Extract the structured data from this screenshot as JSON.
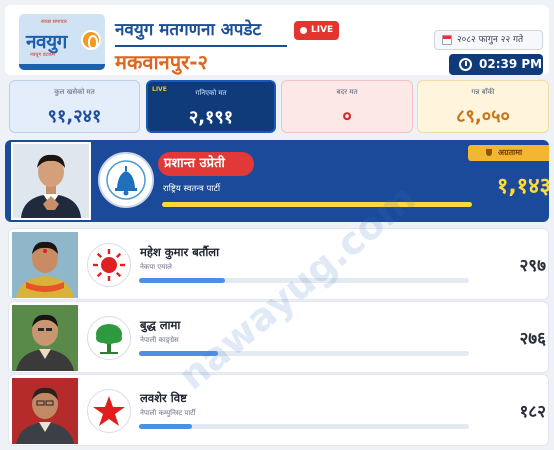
{
  "header": {
    "logo": {
      "word": "नवयुग",
      "tagline": "स्वच्छ समाचार",
      "subline": "नवयुग डटकम"
    },
    "title": "नवयुग मतगणना अपडेट",
    "live_label": "LIVE",
    "constituency": "मकवानपुर-२",
    "date": "२०८२ फागुन २२ गते",
    "time": "02:39 PM"
  },
  "stats": {
    "total_voters": {
      "label": "कुल खसेको मत",
      "value": "९१,२४१"
    },
    "counted": {
      "live": "LIVE",
      "label": "गनिएको मत",
      "value": "२,१९१"
    },
    "invalid": {
      "label": "बदर मत",
      "value": "०"
    },
    "remaining": {
      "label": "गन्न बाँकी",
      "value": "८९,०५०"
    }
  },
  "leader": {
    "name": "प्रशान्त उप्रेती",
    "party": "राष्ट्रिय स्वतन्त्र पार्टी",
    "votes": "१,१४३",
    "leading_label": "अग्रतामा",
    "symbol_icon": "bell-icon",
    "bar_fraction": 1.0
  },
  "candidates": [
    {
      "name": "महेश कुमार बर्तौला",
      "party": "नेकपा एमाले",
      "votes": "२९७",
      "symbol_icon": "sun-icon",
      "bar_fraction": 0.26
    },
    {
      "name": "बुद्ध लामा",
      "party": "नेपाली काङ्ग्रेस",
      "votes": "२७६",
      "symbol_icon": "tree-icon",
      "bar_fraction": 0.24
    },
    {
      "name": "लवशेर विष्ट",
      "party": "नेपाली कम्युनिस्ट पार्टी",
      "votes": "१८२",
      "symbol_icon": "star-icon",
      "bar_fraction": 0.16
    }
  ],
  "watermark": "nawayug.com",
  "colors": {
    "brand_blue": "#0f3b7a",
    "accent_orange": "#e0661f",
    "live_red": "#e3342f",
    "leader_yellow": "#ffd83d"
  }
}
